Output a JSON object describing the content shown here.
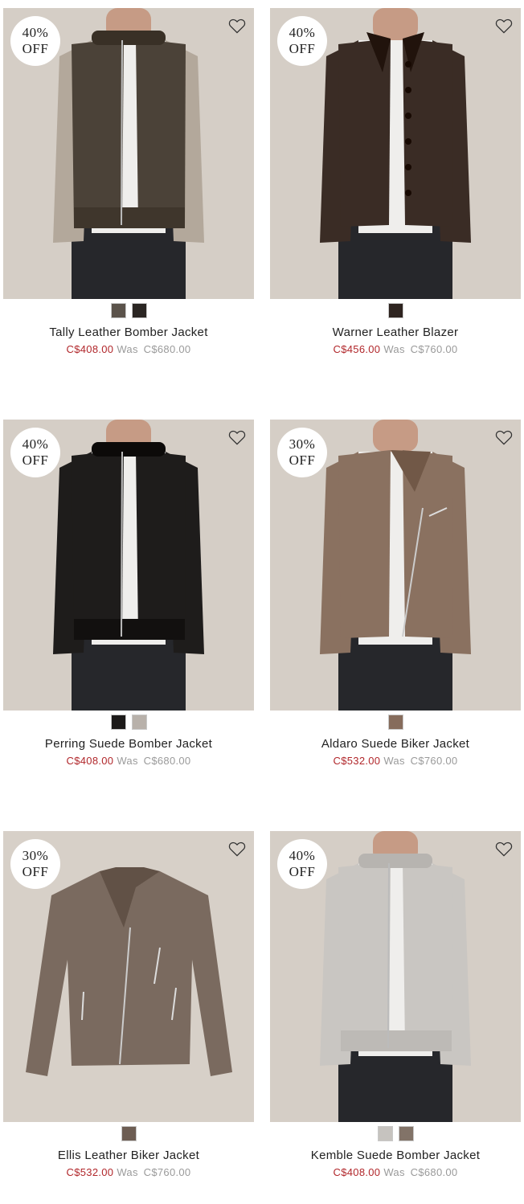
{
  "products": [
    {
      "discount_line1": "40%",
      "discount_line2": "OFF",
      "name": "Tally Leather Bomber Jacket",
      "sale_price": "C$408.00",
      "was_label": "Was",
      "was_price": "C$680.00",
      "swatches": [
        "#5b534b",
        "#2b2623"
      ],
      "jacket_color": "#4b4238",
      "sleeve_color": "#b3a89b",
      "style": "bomber"
    },
    {
      "discount_line1": "40%",
      "discount_line2": "OFF",
      "name": "Warner Leather Blazer",
      "sale_price": "C$456.00",
      "was_label": "Was",
      "was_price": "C$760.00",
      "swatches": [
        "#2e2420"
      ],
      "jacket_color": "#3a2c25",
      "sleeve_color": "#3a2c25",
      "style": "blazer"
    },
    {
      "discount_line1": "40%",
      "discount_line2": "OFF",
      "name": "Perring Suede Bomber Jacket",
      "sale_price": "C$408.00",
      "was_label": "Was",
      "was_price": "C$680.00",
      "swatches": [
        "#1c1a19",
        "#b8b1aa"
      ],
      "jacket_color": "#1e1c1b",
      "sleeve_color": "#1e1c1b",
      "style": "bomber"
    },
    {
      "discount_line1": "30%",
      "discount_line2": "OFF",
      "name": "Aldaro Suede Biker Jacket",
      "sale_price": "C$532.00",
      "was_label": "Was",
      "was_price": "C$760.00",
      "swatches": [
        "#866c5c"
      ],
      "jacket_color": "#8a7160",
      "sleeve_color": "#8a7160",
      "style": "biker"
    },
    {
      "discount_line1": "30%",
      "discount_line2": "OFF",
      "name": "Ellis Leather Biker Jacket",
      "sale_price": "C$532.00",
      "was_label": "Was",
      "was_price": "C$760.00",
      "swatches": [
        "#6d5d53"
      ],
      "jacket_color": "#7a6a5f",
      "sleeve_color": "#7a6a5f",
      "style": "flat-biker"
    },
    {
      "discount_line1": "40%",
      "discount_line2": "OFF",
      "name": "Kemble Suede Bomber Jacket",
      "sale_price": "C$408.00",
      "was_label": "Was",
      "was_price": "C$680.00",
      "swatches": [
        "#c6c3bf",
        "#827368"
      ],
      "jacket_color": "#c9c6c2",
      "sleeve_color": "#c9c6c2",
      "style": "bomber-light"
    }
  ],
  "colors": {
    "sale": "#b1272b",
    "was": "#9a9a9a",
    "photo_bg": "#d7d0c8"
  },
  "icons": {
    "wishlist": "heart-icon"
  }
}
